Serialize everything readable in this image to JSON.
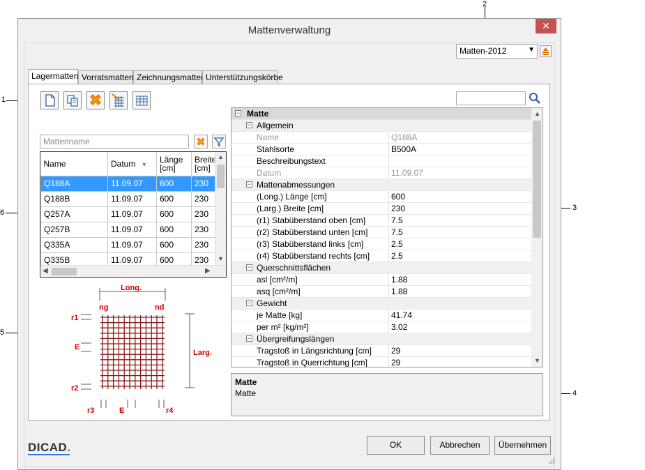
{
  "window": {
    "title": "Mattenverwaltung",
    "close_glyph": "✕"
  },
  "callouts": [
    "1",
    "2",
    "3",
    "4",
    "5",
    "6"
  ],
  "catalog_select": {
    "value": "Matten-2012"
  },
  "tabs": [
    "Lagermatten",
    "Vorratsmatten",
    "Zeichnungsmatten",
    "Unterstützungskörbe"
  ],
  "toolbar": [
    "new-icon",
    "copy-icon",
    "delete-icon",
    "edit-mesh-icon",
    "table-icon"
  ],
  "filter": {
    "placeholder": "Mattenname"
  },
  "grid": {
    "headers": [
      "Name",
      "Datum",
      "Länge [cm]",
      "Breite [cm]"
    ],
    "rows": [
      [
        "Q188A",
        "11.09.07",
        "600",
        "230"
      ],
      [
        "Q188B",
        "11.09.07",
        "600",
        "230"
      ],
      [
        "Q257A",
        "11.09.07",
        "600",
        "230"
      ],
      [
        "Q257B",
        "11.09.07",
        "600",
        "230"
      ],
      [
        "Q335A",
        "11.09.07",
        "600",
        "230"
      ],
      [
        "Q335B",
        "11.09.07",
        "600",
        "230"
      ]
    ]
  },
  "drawing": {
    "long": "Long.",
    "larg": "Larg.",
    "ng": "ng",
    "nd": "nd",
    "r1": "r1",
    "r2": "r2",
    "r3": "r3",
    "r4": "r4",
    "e": "E"
  },
  "properties": {
    "root": "Matte",
    "rows": [
      {
        "type": "cat",
        "label": "Allgemein"
      },
      {
        "label": "Name",
        "value": "Q188A",
        "grey": true
      },
      {
        "label": "Stahlsorte",
        "value": "B500A"
      },
      {
        "label": "Beschreibungstext",
        "value": ""
      },
      {
        "label": "Datum",
        "value": "11.09.07",
        "grey": true
      },
      {
        "type": "cat",
        "label": "Mattenabmessungen"
      },
      {
        "label": "(Long.) Länge [cm]",
        "value": "600"
      },
      {
        "label": "(Larg.) Breite [cm]",
        "value": "230"
      },
      {
        "label": "(r1) Stabüberstand oben [cm]",
        "value": "7.5"
      },
      {
        "label": "(r2) Stabüberstand unten [cm]",
        "value": "7.5"
      },
      {
        "label": "(r3) Stabüberstand links [cm]",
        "value": "2.5"
      },
      {
        "label": "(r4) Stabüberstand rechts [cm]",
        "value": "2.5"
      },
      {
        "type": "cat",
        "label": "Querschnittsflächen"
      },
      {
        "label": "asl [cm²/m]",
        "value": "1.88"
      },
      {
        "label": "asq [cm²/m]",
        "value": "1.88"
      },
      {
        "type": "cat",
        "label": "Gewicht"
      },
      {
        "label": "je Matte [kg]",
        "value": "41.74"
      },
      {
        "label": "per m² [kg/m²]",
        "value": "3.02"
      },
      {
        "type": "cat",
        "label": "Übergreifungslängen"
      },
      {
        "label": "Tragstoß in Längsrichtung [cm]",
        "value": "29"
      },
      {
        "label": "Tragstoß in Querrichtung [cm]",
        "value": "29"
      }
    ]
  },
  "description": {
    "title": "Matte",
    "text": "Matte"
  },
  "logo": "DICAD",
  "buttons": {
    "ok": "OK",
    "cancel": "Abbrechen",
    "apply": "Übernehmen"
  },
  "colors": {
    "accent": "#3399ff",
    "close": "#c75050",
    "mesh": "#8b1a1a",
    "label_red": "#cc0000"
  }
}
